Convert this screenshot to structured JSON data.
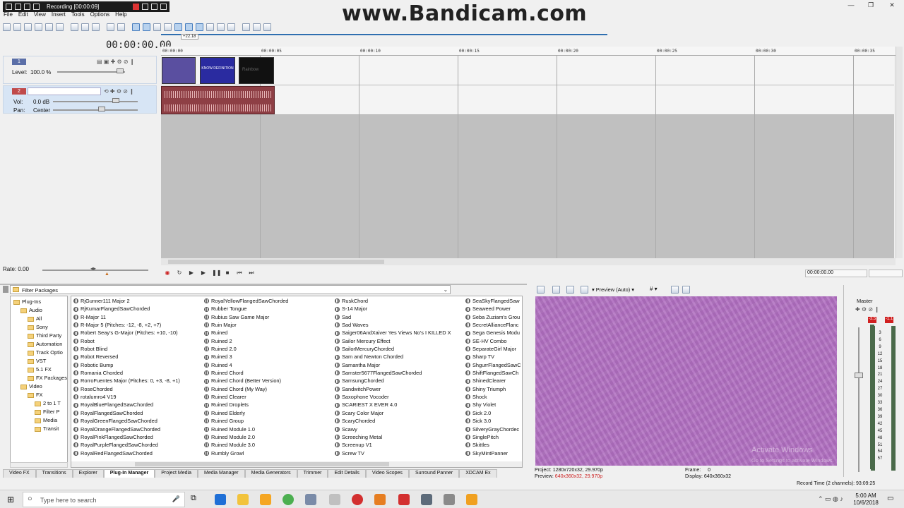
{
  "recording": {
    "label": "Recording [00:00:09]"
  },
  "watermark": "www.Bandicam.com",
  "menu": [
    "File",
    "Edit",
    "View",
    "Insert",
    "Tools",
    "Options",
    "Help"
  ],
  "timecode": "00:00:00.00",
  "ruler_marks": [
    "00:00:00",
    "00:00:05",
    "00:00:10",
    "00:00:15",
    "00:00:20",
    "00:00:25",
    "00:00:30",
    "00:00:35"
  ],
  "cursor_badge": "+22.18",
  "video_track": {
    "number": "1",
    "level_label": "Level:",
    "level_value": "100.0 %"
  },
  "audio_track": {
    "number": "2",
    "vol_label": "Vol:",
    "vol_value": "0.0 dB",
    "pan_label": "Pan:",
    "pan_value": "Center"
  },
  "clip_text": {
    "middle": "KNOW DEFINITION",
    "right": "Rainbow"
  },
  "rate": "Rate: 0.00",
  "bottom_timecode": "00:00:00.00",
  "explorer": {
    "filter_label": "Filter Packages",
    "tree": [
      {
        "label": "Plug-Ins",
        "indent": 0
      },
      {
        "label": "Audio",
        "indent": 1
      },
      {
        "label": "All",
        "indent": 2
      },
      {
        "label": "Sony",
        "indent": 2
      },
      {
        "label": "Third Party",
        "indent": 2
      },
      {
        "label": "Automation",
        "indent": 2
      },
      {
        "label": "Track Optio",
        "indent": 2
      },
      {
        "label": "VST",
        "indent": 2
      },
      {
        "label": "5.1 FX",
        "indent": 2
      },
      {
        "label": "FX Packages",
        "indent": 2
      },
      {
        "label": "Video",
        "indent": 1
      },
      {
        "label": "FX",
        "indent": 2
      },
      {
        "label": "2 to 1 T",
        "indent": 3
      },
      {
        "label": "Filter P",
        "indent": 3
      },
      {
        "label": "Media",
        "indent": 3
      },
      {
        "label": "Transit",
        "indent": 3
      }
    ],
    "columns": [
      [
        "RjGunner111 Major 2",
        "RjKumarFlangedSawChorded",
        "R-Major 11",
        "R-Major 5 (Pitches: -12, -8, +2, +7)",
        "Robert Seay's G-Major (Pitches: +10, -10)",
        "Robot",
        "Robot Blind",
        "Robot Reversed",
        "Robotic Bump",
        "Romania Chorded",
        "RorroFuentes Major (Pitches: 0, +3, -8, +1)",
        "RoseChorded",
        "rotalumro4 V19",
        "RoyalBlueFlangedSawChorded",
        "RoyalFlangedSawChorded",
        "RoyalGreenFlangedSawChorded",
        "RoyalOrangeFlangedSawChorded",
        "RoyalPinkFlangedSawChorded",
        "RoyalPurpleFlangedSawChorded",
        "RoyalRedFlangedSawChorded"
      ],
      [
        "RoyalYellowFlangedSawChorded",
        "Rubber Tongue",
        "Rubius Saw Game Major",
        "Ruin Major",
        "Ruined",
        "Ruined 2",
        "Ruined 2.0",
        "Ruined 3",
        "Ruined 4",
        "Ruined Chord",
        "Ruined Chord (Better Version)",
        "Ruined Chord (My Way)",
        "Ruined Clearer",
        "Ruined Droplets",
        "Ruined Elderly",
        "Ruined Group",
        "Ruined Module 1.0",
        "Ruined Module 2.0",
        "Ruined Module 3.0",
        "Rumbly Growl"
      ],
      [
        "RuskChord",
        "S-14 Major",
        "Sad",
        "Sad Waves",
        "Saiger06AndXaiver Yes Views No's I KILLED X",
        "Sailor Mercury Effect",
        "SailorMercuryChorded",
        "Sam and Newton Chorded",
        "Samantha Major",
        "Samster5677FlangedSawChorded",
        "SamsungChorded",
        "SandwitchPower",
        "Saxophone Vocoder",
        "SCARIEST X EVER 4.0",
        "Scary Color Major",
        "ScaryChorded",
        "Scawy",
        "Screeching Metal",
        "Screenup V1",
        "Screw TV"
      ],
      [
        "SeaSkyFlangedSaw",
        "Seaweed Power",
        "Seba Zuziam's Grou",
        "SecretAllianceFlanc",
        "Sega Genesis Modu",
        "SE-HV Combo",
        "SeparateGirl Major",
        "Sharp TV",
        "ShgurrFlangedSawC",
        "ShiftFlangedSawCh",
        "ShinedClearer",
        "Shiny Triumph",
        "Shock",
        "Shy Violet",
        "Sick 2.0",
        "Sick 3.0",
        "SilveryGrayChordec",
        "SinglePitch",
        "Skittles",
        "SkyMintPanner"
      ]
    ]
  },
  "tabs": [
    "Video FX",
    "Transitions",
    "Explorer",
    "Plug-In Manager",
    "Project Media",
    "Media Manager",
    "Media Generators",
    "Trimmer",
    "Edit Details",
    "Video Scopes",
    "Surround Panner",
    "XDCAM Ex"
  ],
  "active_tab": "Plug-In Manager",
  "preview_panel": {
    "mode": "Preview (Auto)",
    "project_label": "Project:",
    "project_value": "1280x720x32, 29.970p",
    "preview_label": "Preview:",
    "preview_value": "640x360x32, 29.970p",
    "frame_label": "Frame:",
    "frame_value": "0",
    "display_label": "Display:",
    "display_value": "640x360x32",
    "activate_title": "Activate Windows",
    "activate_sub": "Go to Settings to activate Windows."
  },
  "master": {
    "label": "Master",
    "peak_left": "-3.5",
    "peak_right": "-1.1",
    "scale": [
      "3",
      "6",
      "9",
      "12",
      "15",
      "18",
      "21",
      "24",
      "27",
      "30",
      "33",
      "36",
      "39",
      "42",
      "45",
      "48",
      "51",
      "54",
      "57"
    ]
  },
  "status": {
    "record_time": "Record Time (2 channels): 93:09:25"
  },
  "taskbar": {
    "search_placeholder": "Type here to search",
    "time": "5:00 AM",
    "date": "10/6/2018"
  },
  "colors": {
    "preview_bg": "#b06ec0",
    "audio_clip": "#8e3f45",
    "video_track": "#5b6fa8",
    "audio_track": "#c04a4a"
  }
}
